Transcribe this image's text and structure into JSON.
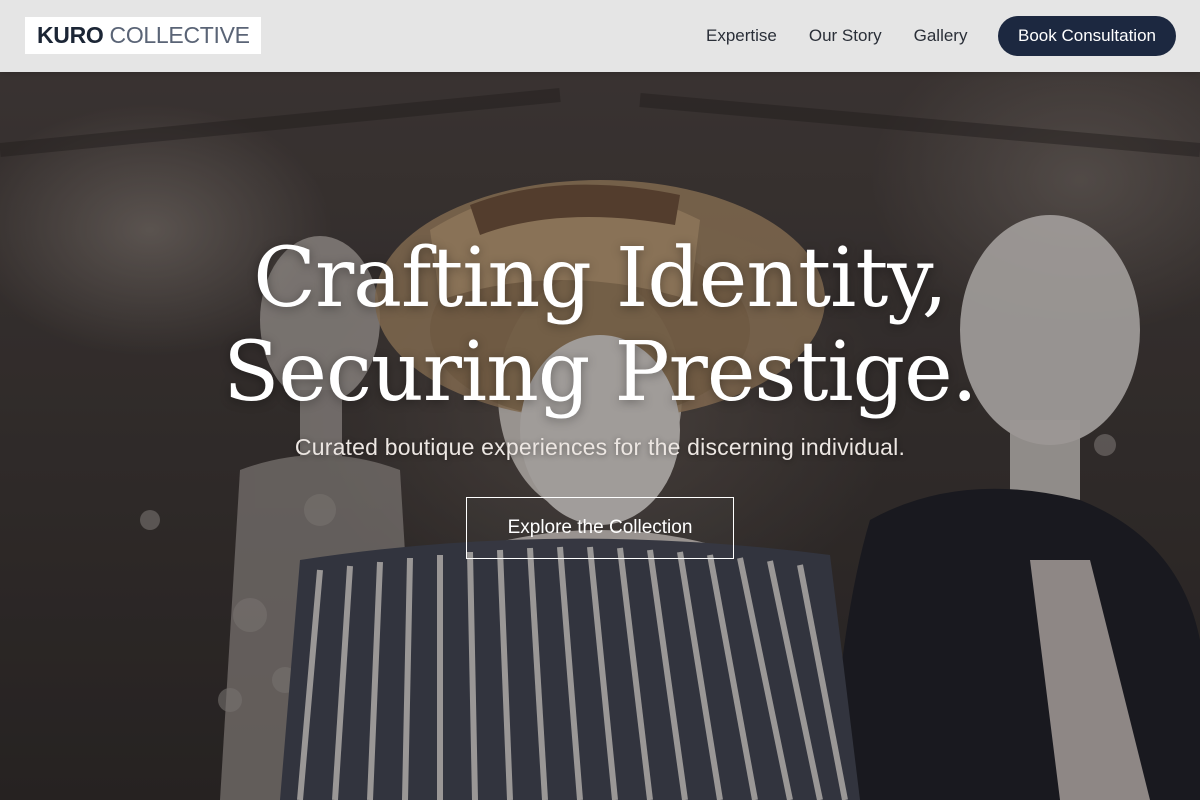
{
  "brand": {
    "strong": "KURO",
    "light": "COLLECTIVE"
  },
  "nav": {
    "items": [
      {
        "label": "Expertise"
      },
      {
        "label": "Our Story"
      },
      {
        "label": "Gallery"
      }
    ],
    "cta_label": "Book Consultation"
  },
  "hero": {
    "title_line1": "Crafting Identity,",
    "title_line2": "Securing Prestige.",
    "subtitle": "Curated boutique experiences for the discerning individual.",
    "cta_label": "Explore the Collection",
    "background_image": "mannequins-boutique-photo"
  },
  "colors": {
    "nav_bg": "#ececec",
    "brand_dark": "#1c2840",
    "text_on_hero": "#ffffff"
  }
}
